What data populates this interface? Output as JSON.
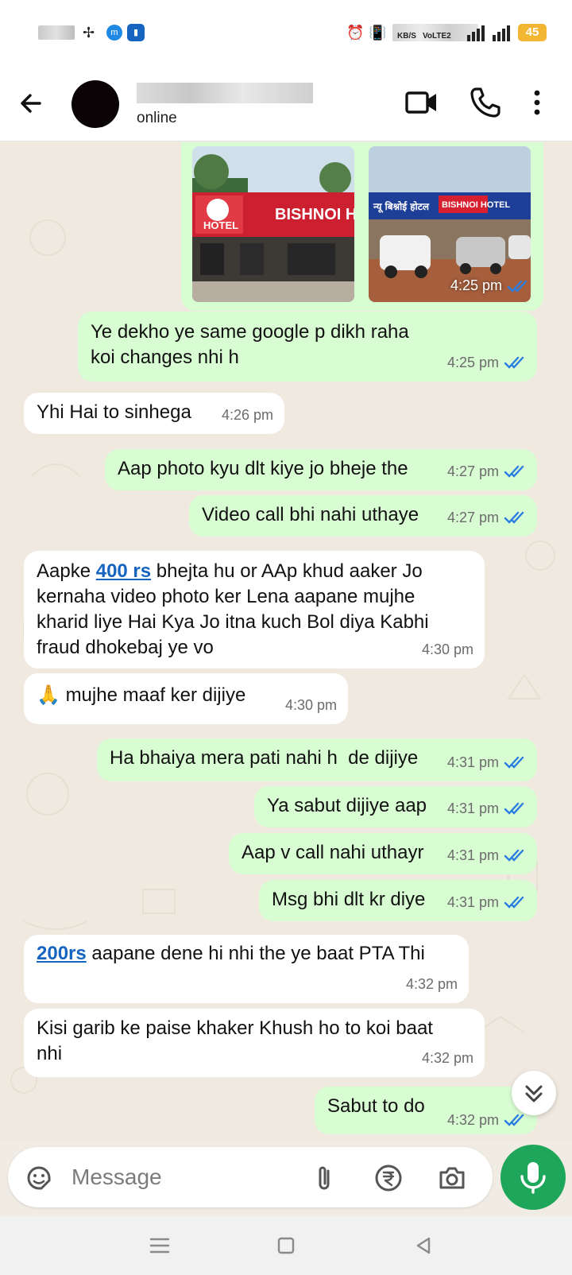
{
  "status_bar": {
    "net_label": "KB/S",
    "volte_label": "VoLTE2",
    "battery": "45"
  },
  "header": {
    "status": "online"
  },
  "messages": [
    {
      "dir": "out",
      "time": "4:25 pm",
      "image_time": "4:25 pm"
    },
    {
      "dir": "out",
      "text": "Ye dekho ye same google p dikh raha koi changes nhi h",
      "time": "4:25 pm"
    },
    {
      "dir": "in",
      "text": "Yhi Hai to sinhega",
      "time": "4:26 pm"
    },
    {
      "dir": "out",
      "text": "Aap photo kyu dlt kiye jo bheje the",
      "time": "4:27 pm"
    },
    {
      "dir": "out",
      "text": "Video call bhi nahi uthaye",
      "time": "4:27 pm"
    },
    {
      "dir": "in",
      "text_before": "Aapke ",
      "link": "400 rs",
      "text_after": " bhejta hu or AAp khud aaker Jo kernaha video photo ker Lena aapane mujhe kharid liye Hai Kya Jo itna kuch Bol diya Kabhi fraud dhokebaj ye vo",
      "time": "4:30 pm"
    },
    {
      "dir": "in",
      "emoji": "🙏",
      "text": "mujhe maaf ker dijiye",
      "time": "4:30 pm"
    },
    {
      "dir": "out",
      "text": "Ha bhaiya mera pati nahi h  de dijiye",
      "time": "4:31 pm"
    },
    {
      "dir": "out",
      "text": "Ya sabut dijiye aap",
      "time": "4:31 pm"
    },
    {
      "dir": "out",
      "text": "Aap v call nahi uthayr",
      "time": "4:31 pm"
    },
    {
      "dir": "out",
      "text": "Msg bhi dlt kr diye",
      "time": "4:31 pm"
    },
    {
      "dir": "in",
      "link": "200rs",
      "text_after": " aapane dene hi nhi the ye baat PTA Thi",
      "time": "4:32 pm"
    },
    {
      "dir": "in",
      "text": "Kisi garib ke paise khaker Khush ho to koi baat nhi",
      "time": "4:32 pm"
    },
    {
      "dir": "out",
      "text": "Sabut to do",
      "time": "4:32 pm"
    }
  ],
  "photos": {
    "left_sign": "BISHNOI HO",
    "left_sign2": "HOTEL",
    "right_sign": "BISHNOI HOTEL"
  },
  "input": {
    "placeholder": "Message"
  },
  "colors": {
    "outgoing_bubble": "#d9fdd3",
    "incoming_bubble": "#ffffff",
    "tick_blue": "#2a7de1",
    "mic_green": "#1ea75a"
  }
}
